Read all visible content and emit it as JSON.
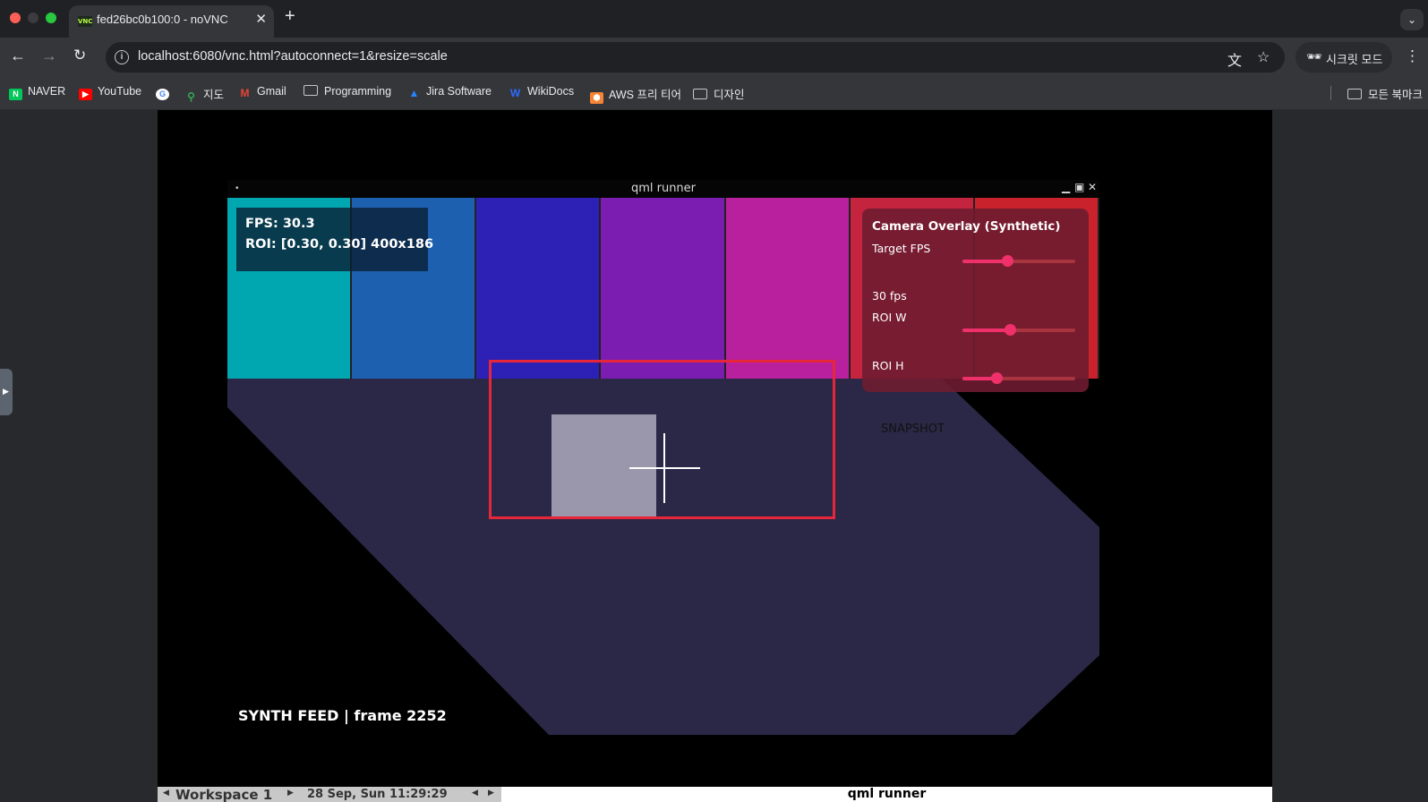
{
  "browser": {
    "tab_title": "fed26bc0b100:0 - noVNC",
    "favicon_text": "VNC",
    "url": "localhost:6080/vnc.html?autoconnect=1&resize=scale",
    "incognito_label": "시크릿 모드"
  },
  "bookmarks": [
    {
      "label": "NAVER",
      "icon": "naver-icon"
    },
    {
      "label": "YouTube",
      "icon": "youtube-icon"
    },
    {
      "label": "",
      "icon": "google-icon"
    },
    {
      "label": "지도",
      "icon": "maps-icon"
    },
    {
      "label": "Gmail",
      "icon": "gmail-icon"
    },
    {
      "label": "Programming",
      "icon": "folder-icon"
    },
    {
      "label": "Jira Software",
      "icon": "jira-icon"
    },
    {
      "label": "WikiDocs",
      "icon": "wikidocs-icon"
    },
    {
      "label": "AWS 프리 티어",
      "icon": "aws-icon"
    },
    {
      "label": "디자인",
      "icon": "folder-icon"
    }
  ],
  "all_bookmarks_label": "모든 북마크",
  "qml": {
    "window_title": "qml runner",
    "fps_text": "FPS: 30.3",
    "roi_text": "ROI: [0.30, 0.30] 400x186",
    "bar_colors": [
      "#00a6b0",
      "#1d60b0",
      "#2d20b4",
      "#7a1db0",
      "#b8209e",
      "#c5243f",
      "#c9222d"
    ],
    "floor_color": "#2a2846",
    "panel": {
      "title": "Camera Overlay (Synthetic)",
      "target_fps_label": "Target FPS",
      "target_fps_value": "30 fps",
      "target_fps_fraction": 0.4,
      "roi_w_label": "ROI W",
      "roi_w_fraction": 0.42,
      "roi_h_label": "ROI H",
      "roi_h_fraction": 0.3
    },
    "snapshot_label": "SNAPSHOT",
    "feed_label": "SYNTH FEED  |  frame 2252",
    "roi_color": "#e8263a"
  },
  "taskbar": {
    "workspace": "Workspace 1",
    "datetime": "28 Sep, Sun 11:29:29",
    "active_window": "qml runner"
  }
}
